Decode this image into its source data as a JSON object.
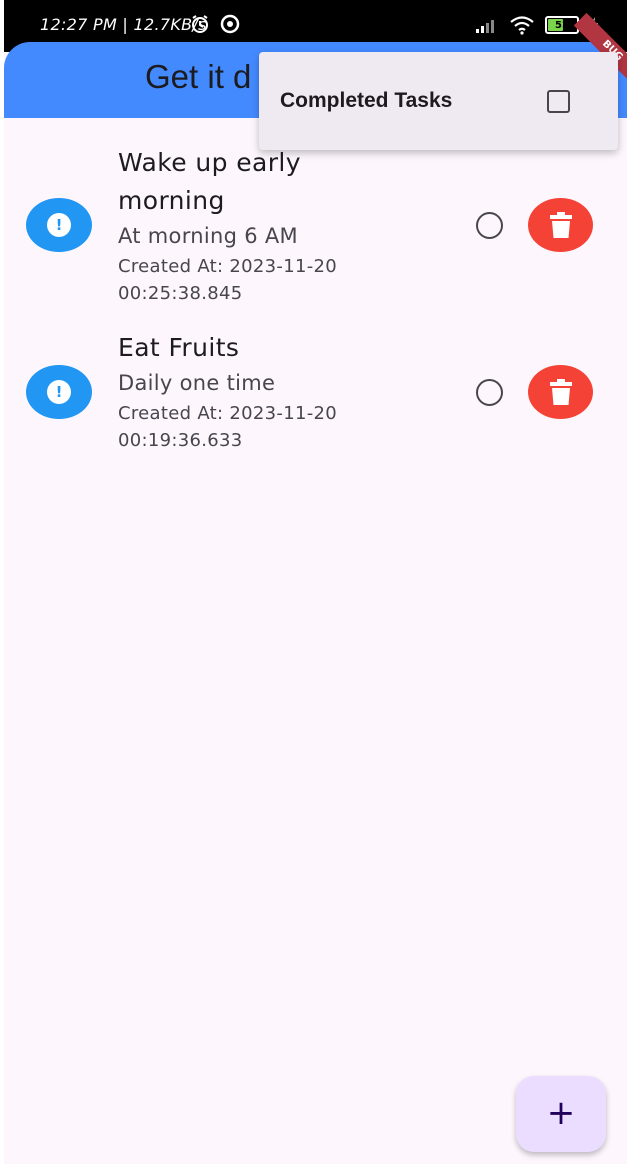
{
  "status_bar": {
    "time": "12:27 PM | 12.7KB/s",
    "battery": "52"
  },
  "app_bar": {
    "title": "Get it d",
    "debug_banner": "BUG"
  },
  "popup_menu": {
    "items": [
      {
        "label": "Completed Tasks",
        "checked": false
      }
    ]
  },
  "tasks": [
    {
      "title_line1": "Wake up early",
      "title_line2": "morning",
      "subtitle": "At morning 6 AM",
      "created_line1": "Created At: 2023-11-20",
      "created_line2": "00:25:38.845",
      "completed": false,
      "icon": "info-icon"
    },
    {
      "title_line1": "Eat Fruits",
      "subtitle": "Daily one time",
      "created_line1": "Created At: 2023-11-20",
      "created_line2": "00:19:36.633",
      "completed": false,
      "icon": "info-icon"
    }
  ],
  "fab": {
    "label": "+"
  },
  "colors": {
    "app_bar": "#448aff",
    "avatar": "#2196f3",
    "delete": "#f44336",
    "fab": "#eaddff",
    "background": "#fdf7fd"
  }
}
